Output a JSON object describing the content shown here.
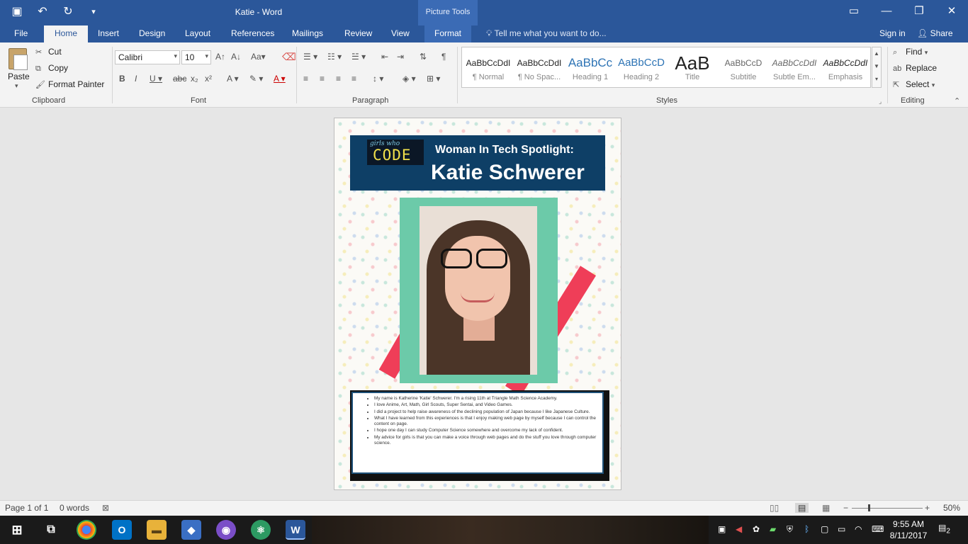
{
  "window": {
    "title": "Katie - Word",
    "context_tab_group": "Picture Tools"
  },
  "tabs": [
    {
      "label": "File"
    },
    {
      "label": "Home"
    },
    {
      "label": "Insert"
    },
    {
      "label": "Design"
    },
    {
      "label": "Layout"
    },
    {
      "label": "References"
    },
    {
      "label": "Mailings"
    },
    {
      "label": "Review"
    },
    {
      "label": "View"
    },
    {
      "label": "Format"
    }
  ],
  "tell_me": "Tell me what you want to do...",
  "account": {
    "sign_in": "Sign in",
    "share": "Share"
  },
  "clipboard": {
    "paste": "Paste",
    "cut": "Cut",
    "copy": "Copy",
    "format_painter": "Format Painter",
    "group_label": "Clipboard"
  },
  "font": {
    "family": "Calibri",
    "size": "10",
    "group_label": "Font"
  },
  "paragraph": {
    "group_label": "Paragraph"
  },
  "styles": {
    "group_label": "Styles",
    "items": [
      {
        "preview": "AaBbCcDdI",
        "name": "¶ Normal"
      },
      {
        "preview": "AaBbCcDdI",
        "name": "¶ No Spac..."
      },
      {
        "preview": "AaBbCc",
        "name": "Heading 1"
      },
      {
        "preview": "AaBbCcD",
        "name": "Heading 2"
      },
      {
        "preview": "AaB",
        "name": "Title"
      },
      {
        "preview": "AaBbCcD",
        "name": "Subtitle"
      },
      {
        "preview": "AaBbCcDdI",
        "name": "Subtle Em..."
      },
      {
        "preview": "AaBbCcDdI",
        "name": "Emphasis"
      }
    ]
  },
  "editing": {
    "find": "Find",
    "replace": "Replace",
    "select": "Select",
    "group_label": "Editing"
  },
  "document": {
    "logo_small": "girls who",
    "logo_big": "CODE",
    "heading": "Woman In Tech Spotlight:",
    "name": "Katie Schwerer",
    "bullets": [
      "My name is Katherine 'Katie' Schwerer. I'm a rising 11th at Triangle Math Science Academy.",
      "I love Anime, Art, Math, Girl Scouts, Super Sentai, and Video Games.",
      "I did a project to help raise awareness of the declining population of Japan because I like Japanese Culture.",
      "What I have learned from this experiences is that I enjoy making web page by myself because I can control the content on page.",
      "I hope one day I can study Computer Science somewhere and overcome my lack of confident.",
      "My advice for girls is that you can make a voice through web pages and do the stuff you love through computer science."
    ]
  },
  "status": {
    "page": "Page 1 of 1",
    "words": "0 words",
    "zoom": "50%"
  },
  "clock": {
    "time": "9:55 AM",
    "date": "8/11/2017"
  },
  "notification_count": "2"
}
